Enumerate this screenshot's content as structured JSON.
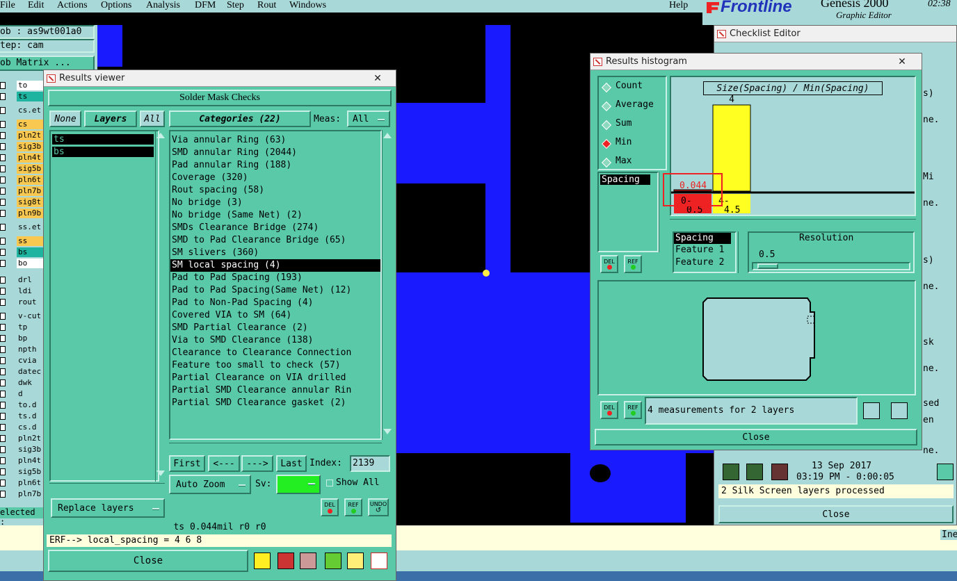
{
  "menubar": {
    "items": [
      "File",
      "Edit",
      "Actions",
      "Options",
      "Analysis",
      "DFM",
      "Step",
      "Rout",
      "Windows"
    ],
    "help": "Help",
    "brand": "Frontline",
    "product": "Genesis 2000",
    "product_sub": "Graphic Editor",
    "clock": "02:38"
  },
  "left_panel": {
    "job": "ob : as9wt001a0",
    "step": "tep: cam",
    "matrix_button": "ob Matrix ...",
    "layers": [
      {
        "name": "to",
        "color": "#ffffff"
      },
      {
        "name": "ts",
        "color": "#1eb4a0"
      },
      {
        "name": "cs.et",
        "color": "#a8d8d8"
      },
      {
        "name": "cs",
        "color": "#f8c850"
      },
      {
        "name": "pln2t",
        "color": "#f8c850"
      },
      {
        "name": "sig3b",
        "color": "#f8c850"
      },
      {
        "name": "pln4t",
        "color": "#f8c850"
      },
      {
        "name": "sig5b",
        "color": "#f8c850"
      },
      {
        "name": "pln6t",
        "color": "#f8c850"
      },
      {
        "name": "pln7b",
        "color": "#f8c850"
      },
      {
        "name": "sig8t",
        "color": "#f8c850"
      },
      {
        "name": "pln9b",
        "color": "#f8c850"
      },
      {
        "name": "ss.et",
        "color": "#a8d8d8"
      },
      {
        "name": "ss",
        "color": "#f8c850"
      },
      {
        "name": "bs",
        "color": "#1eb4a0"
      },
      {
        "name": "bo",
        "color": "#ffffff"
      },
      {
        "name": "drl",
        "color": "#a8d8d8"
      },
      {
        "name": "ldi",
        "color": "#a8d8d8"
      },
      {
        "name": "rout",
        "color": "#a8d8d8"
      },
      {
        "name": "v-cut",
        "color": "#a8d8d8"
      },
      {
        "name": "tp",
        "color": "#a8d8d8"
      },
      {
        "name": "bp",
        "color": "#a8d8d8"
      },
      {
        "name": "npth",
        "color": "#a8d8d8"
      },
      {
        "name": "cvia",
        "color": "#a8d8d8"
      },
      {
        "name": "datec",
        "color": "#a8d8d8"
      },
      {
        "name": "dwk",
        "color": "#a8d8d8"
      },
      {
        "name": "d",
        "color": "#a8d8d8"
      },
      {
        "name": "to.d",
        "color": "#a8d8d8"
      },
      {
        "name": "ts.d",
        "color": "#a8d8d8"
      },
      {
        "name": "cs.d",
        "color": "#a8d8d8"
      },
      {
        "name": "pln2t",
        "color": "#a8d8d8"
      },
      {
        "name": "sig3b",
        "color": "#a8d8d8"
      },
      {
        "name": "pln4t",
        "color": "#a8d8d8"
      },
      {
        "name": "sig5b",
        "color": "#a8d8d8"
      },
      {
        "name": "pln6t",
        "color": "#a8d8d8"
      },
      {
        "name": "pln7b",
        "color": "#a8d8d8"
      }
    ],
    "selected_label": "elected :"
  },
  "results_viewer": {
    "title": "Results viewer",
    "header": "Solder Mask Checks",
    "none_label": "None",
    "layers_label": "Layers",
    "all_label": "All",
    "categories_label": "Categories (22)",
    "meas_label": "Meas:",
    "meas_value": "All",
    "layer_items": [
      "ts",
      "bs"
    ],
    "categories": [
      "Via annular Ring (63)",
      "SMD annular Ring (2044)",
      "Pad annular Ring (188)",
      "Coverage (320)",
      "Rout spacing (58)",
      "No bridge (3)",
      "No bridge (Same Net) (2)",
      "SMDs Clearance Bridge (274)",
      "SMD to Pad Clearance Bridge (65)",
      "SM slivers (360)",
      "SM local spacing (4)",
      "Pad to Pad Spacing (193)",
      "Pad to Pad Spacing(Same Net) (12)",
      "Pad to Non-Pad Spacing (4)",
      "Covered VIA to SM (64)",
      "SMD Partial Clearance (2)",
      "Via to SMD Clearance (138)",
      "Clearance to Clearance Connection",
      "Feature too small to check (57)",
      "Partial Clearance on VIA drilled",
      "Partial SMD Clearance annular Rin",
      "Partial SMD Clearance gasket (2)"
    ],
    "first_label": "First",
    "prev_label": "<---",
    "next_label": "--->",
    "last_label": "Last",
    "index_label": "Index:",
    "index_value": "2139",
    "autozoom_label": "Auto Zoom",
    "sv_label": "Sv:",
    "showall_label": "Show All",
    "replace_label": "Replace layers",
    "del_label": "DEL",
    "ref_label": "REF",
    "undo_label": "UNDO",
    "status": "ts 0.044mil  r0  r0",
    "erf": "ERF--> local_spacing = 4 6 8",
    "close_label": "Close"
  },
  "histogram": {
    "title": "Results histogram",
    "modes": [
      "Count",
      "Average",
      "Sum",
      "Min",
      "Max"
    ],
    "active_mode": "Min",
    "list_item": "Spacing",
    "chart_title": "Size(Spacing) / Min(Spacing)",
    "bar_count": "4",
    "red_value": "0.044",
    "bin1_a": "0-",
    "bin1_b": "0.5",
    "bin2_a": "4-",
    "bin2_b": "4.5",
    "features": [
      "Spacing",
      "Feature 1",
      "Feature 2"
    ],
    "resolution_label": "Resolution",
    "resolution_value": "0.5",
    "measurements": "4 measurements for 2 layers",
    "del_label": "DEL",
    "ref_label": "REF",
    "close_label": "Close"
  },
  "checklist": {
    "title": "Checklist Editor",
    "date": "13 Sep 2017",
    "time": "03:19 PM - 0:00:05",
    "processed": "2 Silk Screen layers processed",
    "close_label": "Close",
    "fragments": [
      "s)",
      "ne.",
      "Mi",
      "ne.",
      "s)",
      "ne.",
      "sk",
      "ne.",
      "sed",
      "en",
      "ne."
    ],
    "ine_label": "Ine"
  },
  "chart_data": {
    "type": "bar",
    "title": "Size(Spacing) / Min(Spacing)",
    "categories": [
      "0-0.5",
      "4-4.5"
    ],
    "values": [
      0.044,
      4
    ],
    "data_labels": [
      "0.044",
      "4"
    ],
    "colors": [
      "#ee2222",
      "#ffff22"
    ]
  }
}
